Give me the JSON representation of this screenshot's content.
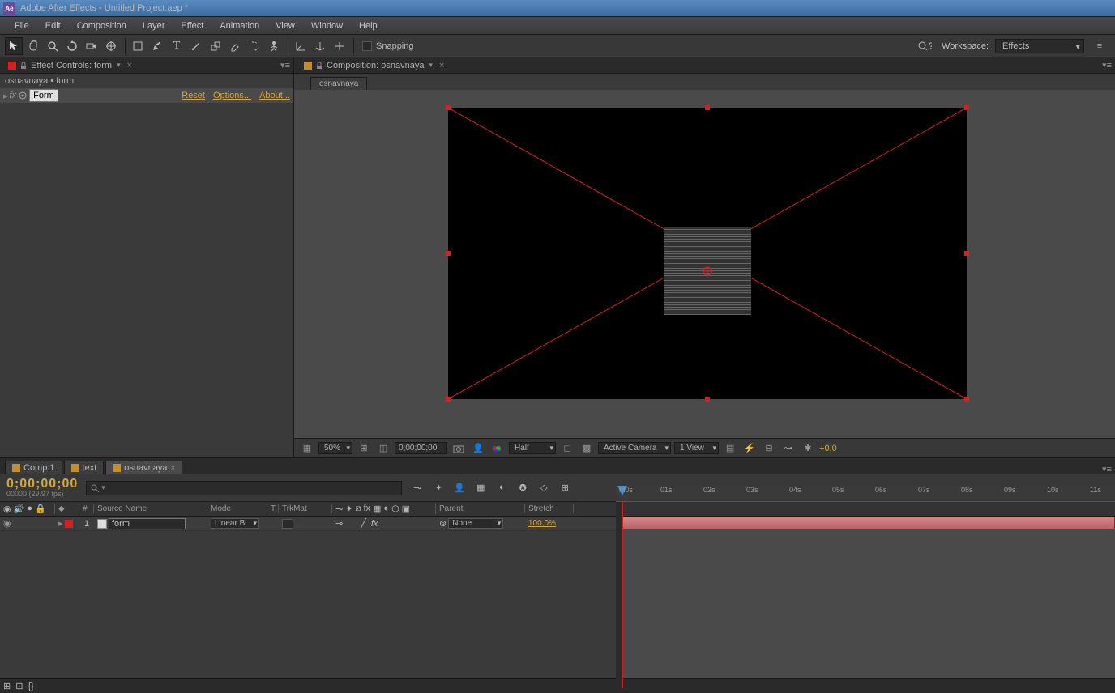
{
  "titlebar": {
    "app_name": "Adobe After Effects",
    "project": "Untitled Project.aep *"
  },
  "menu": [
    "File",
    "Edit",
    "Composition",
    "Layer",
    "Effect",
    "Animation",
    "View",
    "Window",
    "Help"
  ],
  "toolbar": {
    "snapping_label": "Snapping",
    "workspace_label": "Workspace:",
    "workspace_value": "Effects"
  },
  "effect_panel": {
    "tab_title": "Effect Controls: form",
    "breadcrumb": "osnavnaya • form",
    "name": "Form",
    "reset": "Reset",
    "options": "Options...",
    "about": "About..."
  },
  "composition": {
    "tab_title": "Composition: osnavnaya",
    "sub_tab": "osnavnaya"
  },
  "viewport_footer": {
    "zoom": "50%",
    "timecode": "0;00;00;00",
    "resolution": "Half",
    "camera": "Active Camera",
    "views": "1 View",
    "exposure": "+0,0"
  },
  "timeline": {
    "tabs": [
      {
        "label": "Comp 1"
      },
      {
        "label": "text"
      },
      {
        "label": "osnavnaya",
        "active": true
      }
    ],
    "timecode": "0;00;00;00",
    "timecode_sub": "00000 (29.97 fps)",
    "columns": {
      "idx": "#",
      "source": "Source Name",
      "mode": "Mode",
      "t": "T",
      "trkmat": "TrkMat",
      "parent": "Parent",
      "stretch": "Stretch"
    },
    "ticks": [
      "m0s",
      "01s",
      "02s",
      "03s",
      "04s",
      "05s",
      "06s",
      "07s",
      "08s",
      "09s",
      "10s",
      "11s"
    ],
    "layer": {
      "index": "1",
      "name": "form",
      "mode": "Linear Bl",
      "parent": "None",
      "stretch": "100,0%"
    }
  }
}
